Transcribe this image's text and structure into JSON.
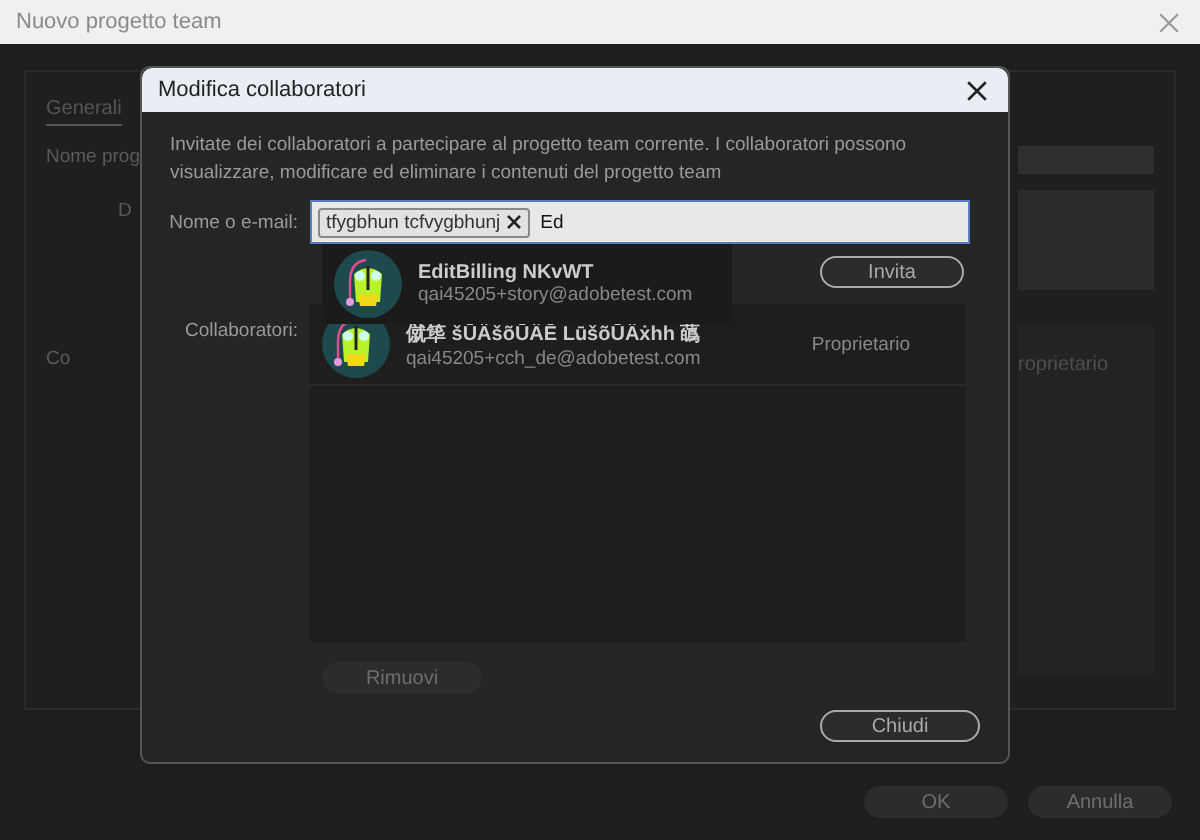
{
  "window": {
    "title": "Nuovo progetto team"
  },
  "background": {
    "tabs": [
      {
        "label": "Generali",
        "selected": true
      }
    ],
    "labels": [
      "Nome prog",
      "D",
      "Co"
    ],
    "role": "roprietario",
    "buttons": [
      {
        "label": "OK",
        "disabled": true
      },
      {
        "label": "Annulla",
        "disabled": true
      }
    ]
  },
  "dialog": {
    "title": "Modifica collaboratori",
    "description": "Invitate dei collaboratori a partecipare al progetto team corrente. I collaboratori possono visualizzare, modificare ed eliminare i contenuti del progetto team",
    "email_label": "Nome o e-mail:",
    "chips": [
      {
        "label": "tfygbhun tcfvygbhunj"
      }
    ],
    "value": "Ed",
    "suggestions": [
      {
        "name": "EditBilling NKvWT",
        "email": "qai45205+story@adobetest.com"
      }
    ],
    "invite_button": "Invita",
    "collaborators_label": "Collaboratori:",
    "collaborators": [
      {
        "name": "僦筚 šŪÄšõŪÄĒ LūšõŪÄẋhh 蘤",
        "email": "qai45205+cch_de@adobetest.com",
        "role": "Proprietario"
      }
    ],
    "remove_button": {
      "label": "Rimuovi",
      "disabled": true
    },
    "close_button": "Chiudi"
  }
}
